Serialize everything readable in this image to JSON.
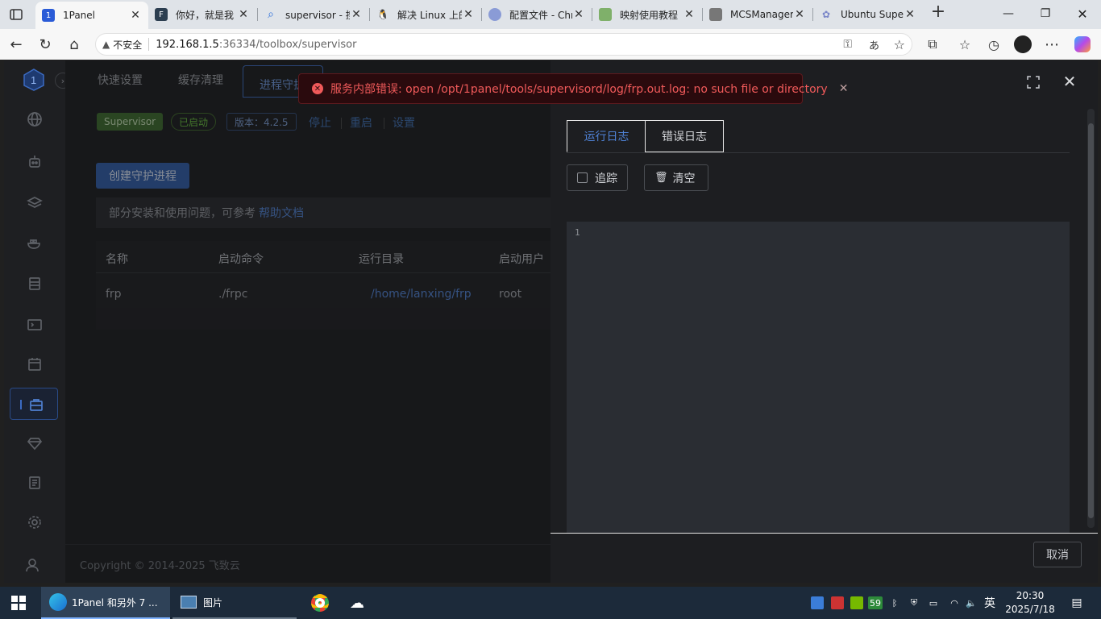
{
  "browser": {
    "tabs": [
      {
        "title": "1Panel",
        "favicon": "1panel-logo",
        "active": true
      },
      {
        "title": "你好，就是我",
        "favicon": "F-icon"
      },
      {
        "title": "supervisor - 搜",
        "favicon": "search-icon"
      },
      {
        "title": "解决 Linux 上的",
        "favicon": "tux-icon"
      },
      {
        "title": "配置文件 - Chr",
        "favicon": "chrome-ext-icon"
      },
      {
        "title": "映射使用教程",
        "favicon": "doc-icon"
      },
      {
        "title": "MCSManager",
        "favicon": "server-icon"
      },
      {
        "title": "Ubuntu Super",
        "favicon": "ubuntu-icon"
      }
    ],
    "new_tab": "+",
    "security_label": "不安全",
    "url_host": "192.168.1.5",
    "url_rest": ":36334/toolbox/supervisor"
  },
  "app": {
    "top_tabs": [
      "快速设置",
      "缓存清理",
      "进程守护"
    ],
    "status": {
      "product": "Supervisor",
      "state": "已启动",
      "version": "版本：4.2.5",
      "stop": "停止",
      "restart": "重启",
      "settings": "设置"
    },
    "create_button": "创建守护进程",
    "hint_text": "部分安装和使用问题，可参考",
    "hint_link": "帮助文档",
    "table": {
      "headers": [
        "名称",
        "启动命令",
        "运行目录",
        "启动用户"
      ],
      "rows": [
        {
          "name": "frp",
          "command": "./frpc",
          "dir": "/home/lanxing/frp",
          "user": "root"
        }
      ]
    },
    "copyright": "Copyright © 2014-2025 飞致云"
  },
  "drawer": {
    "tabs": [
      "运行日志",
      "错误日志"
    ],
    "track_label": "追踪",
    "clear_label": "清空",
    "line_number": "1",
    "cancel_label": "取消"
  },
  "toast": {
    "message": "服务内部错误: open /opt/1panel/tools/supervisord/log/frp.out.log: no such file or directory"
  },
  "taskbar": {
    "edge_label": "1Panel 和另外 7 ...",
    "photos_label": "图片",
    "ime": "英",
    "badge": "59",
    "time": "20:30",
    "date": "2025/7/18"
  },
  "colors": {
    "accent": "#3d6fb5",
    "error": "#f05a5a",
    "success": "#67c23a"
  }
}
